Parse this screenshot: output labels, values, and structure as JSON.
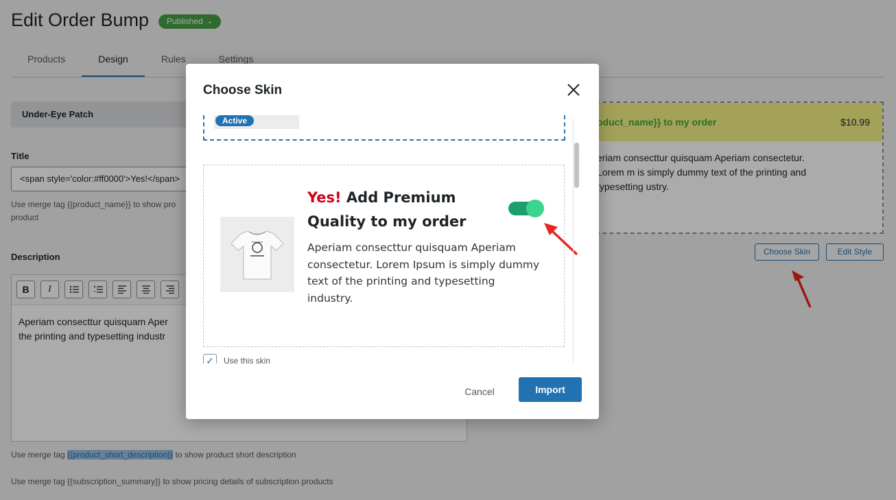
{
  "page": {
    "title": "Edit Order Bump",
    "status": "Published",
    "tabs": [
      "Products",
      "Design",
      "Rules",
      "Settings"
    ],
    "active_tab": "Design"
  },
  "left": {
    "product_name": "Under-Eye Patch",
    "title_label": "Title",
    "title_value": "<span style='color:#ff0000'>Yes!</span>",
    "title_help": "Use merge tag {{product_name}} to show pro",
    "title_help_2": "product",
    "description_label": "Description",
    "description_text": "Aperiam consecttur quisquam Aper\nthe printing and typesetting industr",
    "help_short_prefix": "Use merge tag ",
    "help_short_tag": "{{product_short_description}}",
    "help_short_suffix": " to show product short description",
    "help_subscription": "Use merge tag {{subscription_summary}} to show pricing details of subscription products"
  },
  "toolbar": {
    "bold": "B",
    "italic": "I"
  },
  "preview": {
    "heading": "oduct_name}} to my order",
    "price": "$10.99",
    "body": "eriam consecttur quisquam Aperiam consectetur. Lorem m is simply dummy text of the printing and typesetting ustry.",
    "choose_skin": "Choose Skin",
    "edit_style": "Edit Style"
  },
  "modal": {
    "title": "Choose Skin",
    "active_badge": "Active",
    "skin_yes": "Yes!",
    "skin_heading": "Add Premium Quality to my order",
    "skin_desc": "Aperiam consecttur quisquam Aperiam consectetur. Lorem Ipsum is simply dummy text of the printing and typesetting industry.",
    "use_skin": "Use this skin",
    "cancel": "Cancel",
    "import": "Import"
  },
  "colors": {
    "accent": "#2271b1",
    "published": "#46a046",
    "preview_header": "#f5f285",
    "preview_title": "#3fa640",
    "yes_red": "#d0021b",
    "toggle": "#3cd58e"
  }
}
